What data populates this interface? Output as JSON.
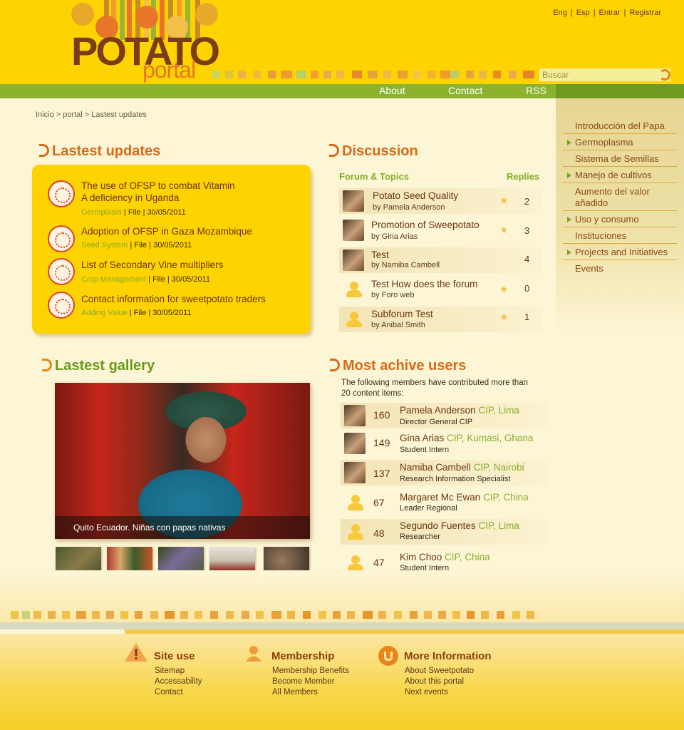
{
  "logo": {
    "word1": "POTATO",
    "word2": "portal"
  },
  "top_links": [
    "Eng",
    "Esp",
    "Entrar",
    "Registrar"
  ],
  "search": {
    "placeholder": "Buscar"
  },
  "nav": {
    "about": "About",
    "contact": "Contact",
    "rss": "RSS"
  },
  "breadcrumb": "Inicio > portal > Lastest updates",
  "sidebar": {
    "items": [
      "Introducción del Papa",
      "Germoplasma",
      "Sistema de Semillas",
      "Manejo de cultivos",
      "Aumento del valor añadido",
      "Uso y consumo",
      "Instituciones",
      "Projects and Initiatives",
      "Events"
    ]
  },
  "updates": {
    "title": "Lastest updates",
    "items": [
      {
        "title": "The use of OFSP to combat Vitamin A deficiency in Uganda",
        "category": "Germplasm",
        "meta": " | File | 30/05/2011"
      },
      {
        "title": "Adoption of OFSP in Gaza Mozambique",
        "category": "Seed System",
        "meta": " | File | 30/05/2011"
      },
      {
        "title": "List of Secondary Vine multipliers",
        "category": "Crop Management",
        "meta": " | File | 30/05/2011"
      },
      {
        "title": "Contact information for sweetpotato traders",
        "category": "Adding Value",
        "meta": " | File | 30/05/2011"
      }
    ]
  },
  "discussion": {
    "title": "Discussion",
    "col_topics": "Forum & Topics",
    "col_replies": "Replies",
    "rows": [
      {
        "title": "Potato Seed Quality",
        "by": "by Pamela Anderson",
        "replies": "2"
      },
      {
        "title": "Promotion of Sweepotato",
        "by": "by Gina Arias",
        "replies": "3"
      },
      {
        "title": "Test",
        "by": "by Namiba Cambell",
        "replies": "4"
      },
      {
        "title": "Test How does the forum",
        "by": "by Foro web",
        "replies": "0"
      },
      {
        "title": "Subforum Test",
        "by": "by Anibal Smith",
        "replies": "1"
      }
    ]
  },
  "gallery": {
    "title": "Lastest gallery",
    "caption": "Quito Ecuador. Niñas con papas nativas"
  },
  "users": {
    "title": "Most achive users",
    "intro": "The following members have contributed more than 20 content items:",
    "rows": [
      {
        "score": "160",
        "name": "Pamela Anderson",
        "org": "CIP, Lima",
        "role": "Director General CIP"
      },
      {
        "score": "149",
        "name": "Gina Arias",
        "org": "CIP, Kumasi, Ghana",
        "role": "Student Intern"
      },
      {
        "score": "137",
        "name": "Namiba Cambell",
        "org": "CIP, Nairobi",
        "role": "Research Information Specialist"
      },
      {
        "score": "67",
        "name": "Margaret Mc Ewan",
        "org": "CIP, China",
        "role": "Leader Regional"
      },
      {
        "score": "48",
        "name": "Segundo Fuentes",
        "org": "CIP, Lima",
        "role": "Researcher"
      },
      {
        "score": "47",
        "name": "Kim Choo",
        "org": "CIP, China",
        "role": "Student Intern"
      }
    ]
  },
  "footer": {
    "site_use": {
      "title": "Site use",
      "links": [
        "Sitemap",
        "Accessability",
        "Contact"
      ]
    },
    "membership": {
      "title": "Membership",
      "links": [
        "Membership Benefits",
        "Become Member",
        "All Members"
      ]
    },
    "more_info": {
      "title": "More Information",
      "links": [
        "About Sweetpotato",
        "About this portal",
        "Next events"
      ]
    }
  },
  "colors": {
    "header_yellow": "#ffd300",
    "nav_green": "#8db32e",
    "title_orange": "#d86a1a",
    "title_green": "#6a9a1c",
    "link_brown": "#6b3410",
    "category_green": "#86ac2a"
  },
  "icons": {
    "search": "search-icon",
    "star": "star-icon",
    "warning": "warning-icon",
    "member": "member-icon",
    "info": "info-icon"
  }
}
